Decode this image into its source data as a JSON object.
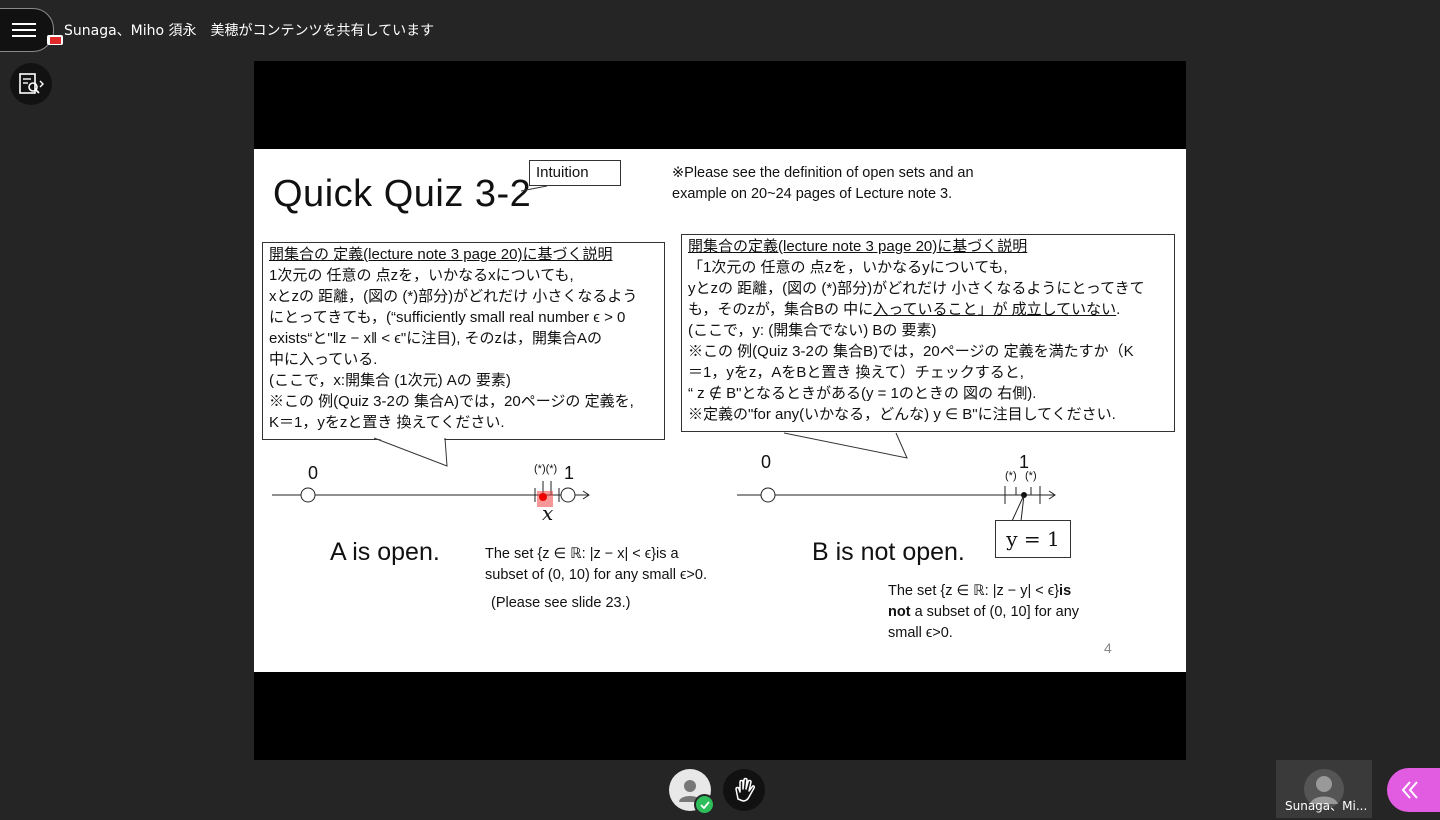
{
  "topbar": {
    "share_text": "Sunaga、Miho 須永　美穂がコンテンツを共有しています"
  },
  "icons": {
    "menu": "hamburger-menu-icon",
    "recording": "recording-camera-icon",
    "follow": "presentation-follow-icon",
    "avatar": "person-avatar-icon",
    "check": "check-badge-icon",
    "raise_hand": "raise-hand-icon",
    "collapse": "double-chevron-left-icon"
  },
  "slide": {
    "title": "Quick Quiz 3-2",
    "intuition": "Intuition",
    "note_lines": [
      "※Please see the definition of open sets and an",
      "example on 20~24 pages of Lecture note 3."
    ],
    "box_a": {
      "heading": "開集合の 定義(lecture note 3 page 20)に基づく説明",
      "lines": [
        "1次元の 任意の 点zを，いかなるxについても,",
        "xとzの 距離，(図の (*)部分)がどれだけ 小さくなるよう",
        "にとってきても，(“sufficiently small real number ϵ > 0",
        "exists“と\"‖z − x‖ < ϵ\"に注目), そのzは，開集合Aの",
        "中に入っている.",
        "(ここで，x:開集合 (1次元) Aの 要素)",
        "※この 例(Quiz 3-2の 集合A)では，20ページの 定義を,",
        "K＝1，yをzと置き 換えてください."
      ]
    },
    "box_b": {
      "heading": "開集合の定義(lecture note 3 page 20)に基づく説明",
      "line1": "「1次元の 任意の 点zを，いかなるyについても,",
      "line2": "yとzの 距離，(図の (*)部分)がどれだけ 小さくなるようにとってきて",
      "line3_a": "も，そのzが，集合Bの 中に",
      "line3_b": "入っていること」が 成立していない",
      "line3_c": ".",
      "lines_rest": [
        "(ここで，y: (開集合でない) Bの 要素)",
        "※この 例(Quiz 3-2の 集合B)では，20ページの 定義を満たすか（K",
        "＝1，yをz，AをBと置き 換えて）チェックすると,",
        "“ z ∉ B\"となるときがある(y = 1のときの 図の 右側).",
        "※定義の\"for any(いかなる，どんな) y ∈ B\"に注目してください."
      ]
    },
    "line_a": {
      "zero": "0",
      "one": "1",
      "star": "(*)(*)",
      "x": "x"
    },
    "line_b": {
      "zero": "0",
      "one": "1",
      "star1": "(*)",
      "star2": "(*)",
      "y_label": "y = 1"
    },
    "a_open": "A is open.",
    "b_not_open": "B is not open.",
    "a_set_lines": [
      "The set {z ∈ ℝ: |z − x| < ϵ}is  a",
      "subset of (0, 10) for any small ϵ>0."
    ],
    "a_see": "(Please see slide 23.)",
    "b_set_line1": "The set {z ∈ ℝ: |z − y| < ϵ}",
    "b_set_bold1": "is",
    "b_set_bold2": "not",
    "b_set_line2": " a subset of (0, 10] for any",
    "b_set_line3": "small ϵ>0.",
    "page_number": "4"
  },
  "participant": {
    "name": "Sunaga、Mi..."
  }
}
